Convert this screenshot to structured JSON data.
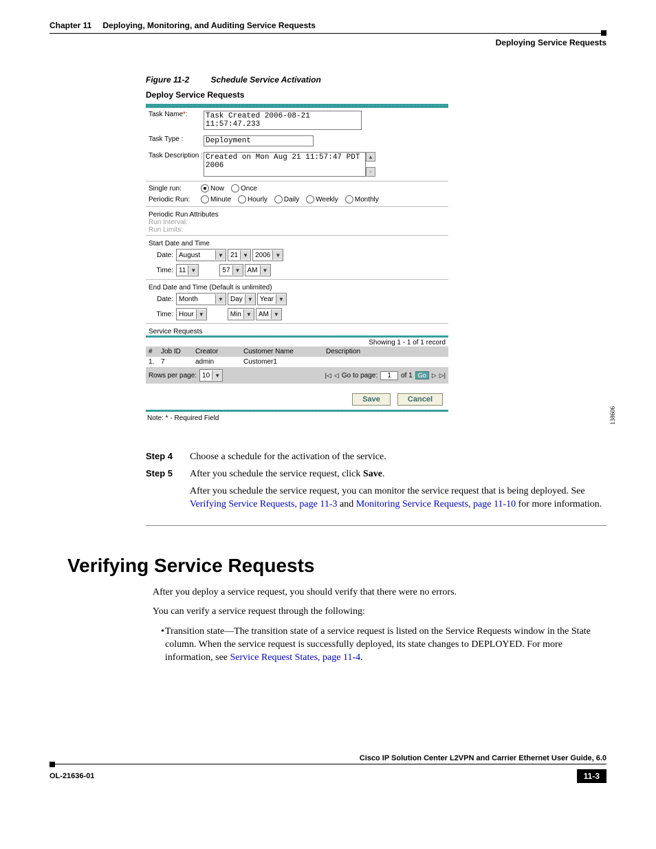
{
  "header": {
    "chapter": "Chapter 11",
    "chapter_title": "Deploying, Monitoring, and Auditing Service Requests",
    "section": "Deploying Service Requests"
  },
  "figure": {
    "num": "Figure 11-2",
    "title": "Schedule Service Activation",
    "id": "138606"
  },
  "ss": {
    "title": "Deploy Service Requests",
    "task_name_label": "Task Name",
    "asterisk": "*",
    "colon": ":",
    "task_name_value": "Task Created 2006-08-21 11:57:47.233",
    "task_type_label": "Task Type :",
    "task_type_value": "Deployment",
    "task_desc_label": "Task Description :",
    "task_desc_value": "Created on Mon Aug 21 11:57:47 PDT 2006",
    "single_run": "Single run:",
    "now": "Now",
    "once": "Once",
    "periodic_run": "Periodic Run:",
    "minute": "Minute",
    "hourly": "Hourly",
    "daily": "Daily",
    "weekly": "Weekly",
    "monthly": "Monthly",
    "periodic_attrs": "Periodic Run Attributes",
    "run_interval": "Run Interval:",
    "run_limits": "Run Limits:",
    "start_dt": "Start Date and Time",
    "date_label": "Date:",
    "time_label": "Time:",
    "start_month": "August",
    "start_day": "21",
    "start_year": "2006",
    "start_hour": "11",
    "start_min": "57",
    "start_ampm": "AM",
    "end_dt": "End Date and Time (Default is unlimited)",
    "end_month": "Month",
    "end_day": "Day",
    "end_year": "Year",
    "end_hour": "Hour",
    "end_min": "Min",
    "end_ampm": "AM",
    "sr_heading": "Service Requests",
    "showing": "Showing 1 - 1 of 1 record",
    "col_hash": "#",
    "col_job": "Job ID",
    "col_creator": "Creator",
    "col_cust": "Customer Name",
    "col_desc": "Description",
    "row_num": "1.",
    "row_job": "7",
    "row_creator": "admin",
    "row_cust": "Customer1",
    "rows_per_page": "Rows per page:",
    "rpp_value": "10",
    "goto_page": "Go to page:",
    "goto_value": "1",
    "of1": "of 1",
    "go": "Go",
    "save": "Save",
    "cancel": "Cancel",
    "note": "Note: * - Required Field"
  },
  "steps": {
    "s4_label": "Step 4",
    "s4_text": "Choose a schedule for the activation of the service.",
    "s5_label": "Step 5",
    "s5_text_a": "After you schedule the service request, click ",
    "s5_save": "Save",
    "s5_text_b": ".",
    "s5_para_a": "After you schedule the service request, you can monitor the service request that is being deployed. See ",
    "s5_link1": "Verifying Service Requests, page 11-3",
    "s5_mid": " and ",
    "s5_link2": "Monitoring Service Requests, page 11-10",
    "s5_para_b": " for more information."
  },
  "section2": {
    "heading": "Verifying Service Requests",
    "p1": "After you deploy a service request, you should verify that there were no errors.",
    "p2": "You can verify a service request through the following:",
    "bullet_a": "Transition state—The transition state of a service request is listed on the Service Requests window in the State column. When the service request is successfully deployed, its state changes to DEPLOYED. For more information, see ",
    "bullet_link": "Service Request States, page 11-4",
    "bullet_b": "."
  },
  "footer": {
    "guide": "Cisco IP Solution Center L2VPN and Carrier Ethernet User Guide, 6.0",
    "docnum": "OL-21636-01",
    "pagenum": "11-3"
  }
}
